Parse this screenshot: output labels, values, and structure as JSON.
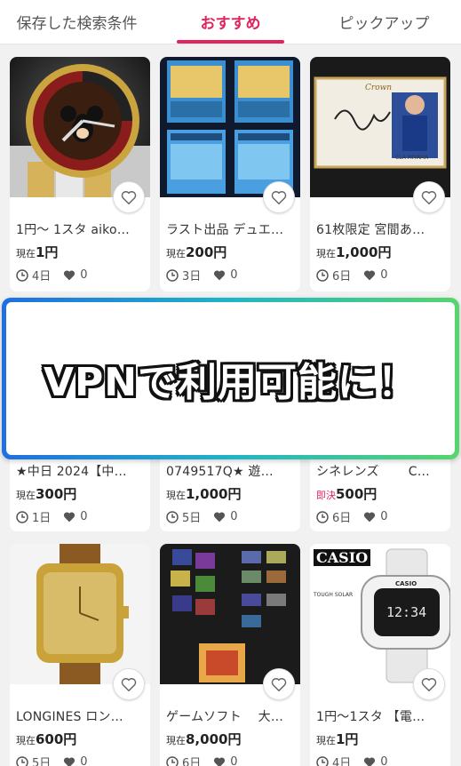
{
  "tabs": [
    {
      "label": "保存した検索条件",
      "active": false
    },
    {
      "label": "おすすめ",
      "active": true
    },
    {
      "label": "ピックアップ",
      "active": false
    }
  ],
  "banner": {
    "text": "VPNで利用可能に！"
  },
  "thumb_text": {
    "card3_brand": "Crown",
    "card3_name": "CLA MIYAMA",
    "card9_brand": "CASIO",
    "card9_tag": "TOUGH SOLAR",
    "card9_watch_brand": "CASIO",
    "card9_time": "12:34"
  },
  "items": [
    {
      "title": "1円～ 1スタ aiko…",
      "price_label": "現在",
      "price": "1円",
      "days": "4日",
      "likes": "0"
    },
    {
      "title": "ラスト出品 デュエ…",
      "price_label": "現在",
      "price": "200円",
      "days": "3日",
      "likes": "0"
    },
    {
      "title": "61枚限定 宮間あ…",
      "price_label": "現在",
      "price": "1,000円",
      "days": "6日",
      "likes": "0"
    },
    {
      "title": "★中日 2024【中…",
      "price_label": "現在",
      "price": "300円",
      "days": "1日",
      "likes": "0"
    },
    {
      "title": "0749517Q★ 遊…",
      "price_label": "現在",
      "price": "1,000円",
      "days": "5日",
      "likes": "0"
    },
    {
      "title": "シネレンズ　　 C…",
      "price_label": "即決",
      "price": "500円",
      "days": "6日",
      "likes": "0"
    },
    {
      "title": "LONGINES ロン…",
      "price_label": "現在",
      "price": "600円",
      "days": "5日",
      "likes": "0"
    },
    {
      "title": "ゲームソフト　 大…",
      "price_label": "現在",
      "price": "8,000円",
      "days": "6日",
      "likes": "0"
    },
    {
      "title": "1円～1スタ 【電…",
      "price_label": "現在",
      "price": "1円",
      "days": "4日",
      "likes": "0"
    }
  ],
  "colors": {
    "accent": "#e0245e",
    "background": "#f1f1f1"
  }
}
